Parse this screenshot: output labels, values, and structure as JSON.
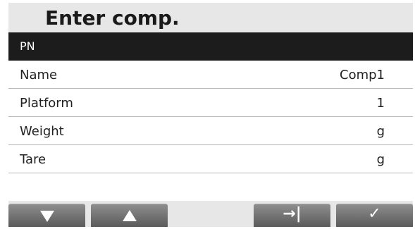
{
  "title": "Enter comp.",
  "header": {
    "label": "PN"
  },
  "rows": [
    {
      "label": "Name",
      "value": "Comp1"
    },
    {
      "label": "Platform",
      "value": "1"
    },
    {
      "label": "Weight",
      "value": "g"
    },
    {
      "label": "Tare",
      "value": "g"
    }
  ],
  "softkeys": [
    {
      "name": "down-arrow-icon",
      "glyph": "▼"
    },
    {
      "name": "up-arrow-icon",
      "glyph": "▲"
    },
    {
      "name": "tab-next-icon",
      "glyph": "→|"
    },
    {
      "name": "checkmark-icon",
      "glyph": "✓"
    }
  ],
  "colors": {
    "background": "#e7e7e7",
    "header_bg": "#1c1c1c",
    "row_bg": "#ffffff",
    "key_bg": "#6e6e6e"
  }
}
